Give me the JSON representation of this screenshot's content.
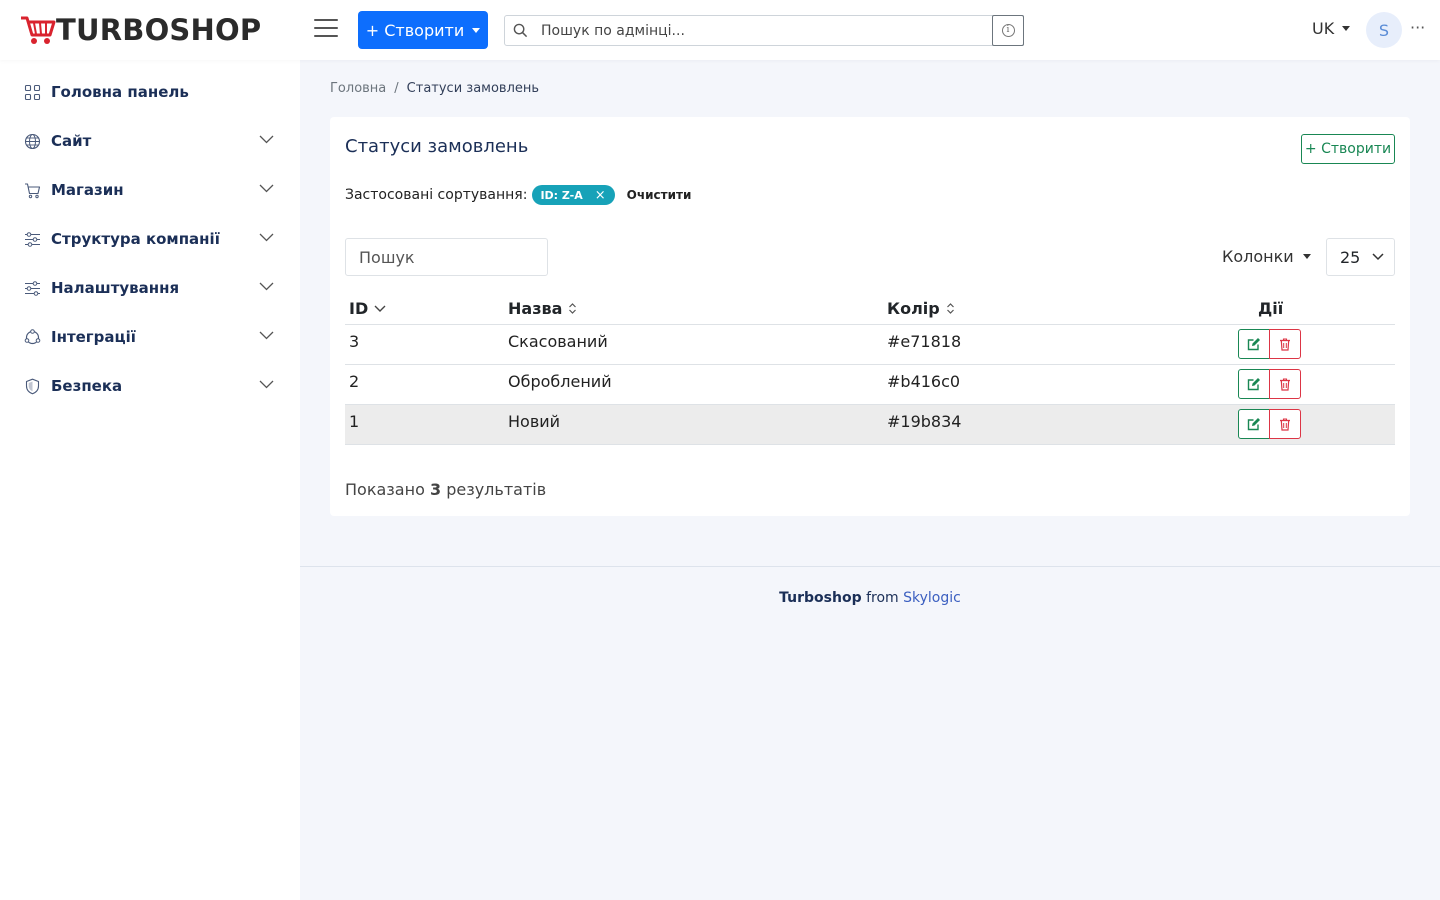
{
  "header": {
    "logo_text": "TURBOSHOP",
    "create_label": "+ Створити",
    "search_placeholder": "Пошук по адмінці...",
    "lang": "UK",
    "avatar_initial": "S",
    "more": "···"
  },
  "sidebar": {
    "items": [
      {
        "label": "Головна панель",
        "icon": "grid-icon"
      },
      {
        "label": "Сайт",
        "icon": "globe-icon"
      },
      {
        "label": "Магазин",
        "icon": "cart-icon"
      },
      {
        "label": "Структура компанії",
        "icon": "sliders-icon"
      },
      {
        "label": "Налаштування",
        "icon": "settings-sliders-icon"
      },
      {
        "label": "Інтеграції",
        "icon": "integrations-icon"
      },
      {
        "label": "Безпека",
        "icon": "shield-icon"
      }
    ]
  },
  "breadcrumb": {
    "home": "Головна",
    "separator": "/",
    "current": "Статуси замовлень"
  },
  "card": {
    "title": "Статуси замовлень",
    "create_label": "+ Створити",
    "sort_label": "Застосовані сортування:",
    "sort_badge": "ID: Z-A",
    "sort_badge_close": "×",
    "sort_clear": "Очистити",
    "search_placeholder": "Пошук",
    "columns_label": "Колонки",
    "per_page": "25"
  },
  "table": {
    "headers": {
      "id": "ID",
      "name": "Назва",
      "color": "Колір",
      "actions": "Дії"
    },
    "rows": [
      {
        "id": "3",
        "name": "Скасований",
        "color": "#e71818"
      },
      {
        "id": "2",
        "name": "Оброблений",
        "color": "#b416c0"
      },
      {
        "id": "1",
        "name": "Новий",
        "color": "#19b834"
      }
    ]
  },
  "summary": {
    "prefix": "Показано",
    "count": "3",
    "suffix": "результатів"
  },
  "footer": {
    "brand": "Turboshop",
    "from": "from",
    "company": "Skylogic"
  },
  "colors": {
    "primary": "#0d6efd",
    "success": "#198754",
    "danger": "#dc3545",
    "info": "#17a2b8",
    "nav_text": "#1b2f57"
  }
}
